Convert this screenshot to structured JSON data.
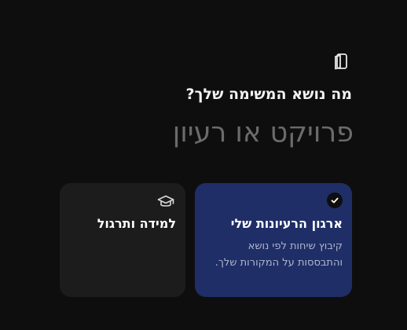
{
  "header": {
    "question": "מה נושא המשימה שלך?"
  },
  "name_field": {
    "placeholder": "פרויקט או רעיון",
    "value": ""
  },
  "options": [
    {
      "title": "ארגון הרעיונות שלי",
      "description": "קיבוץ שיחות לפי נושא והתבססות על המקורות שלך.",
      "selected": true,
      "icon": "check-circle-icon",
      "background": "#1f2e66"
    },
    {
      "title": "למידה ותרגול",
      "selected": false,
      "icon": "graduation-cap-icon",
      "background": "#1c1c1d"
    }
  ],
  "icons": {
    "top": "notebook-icon"
  }
}
